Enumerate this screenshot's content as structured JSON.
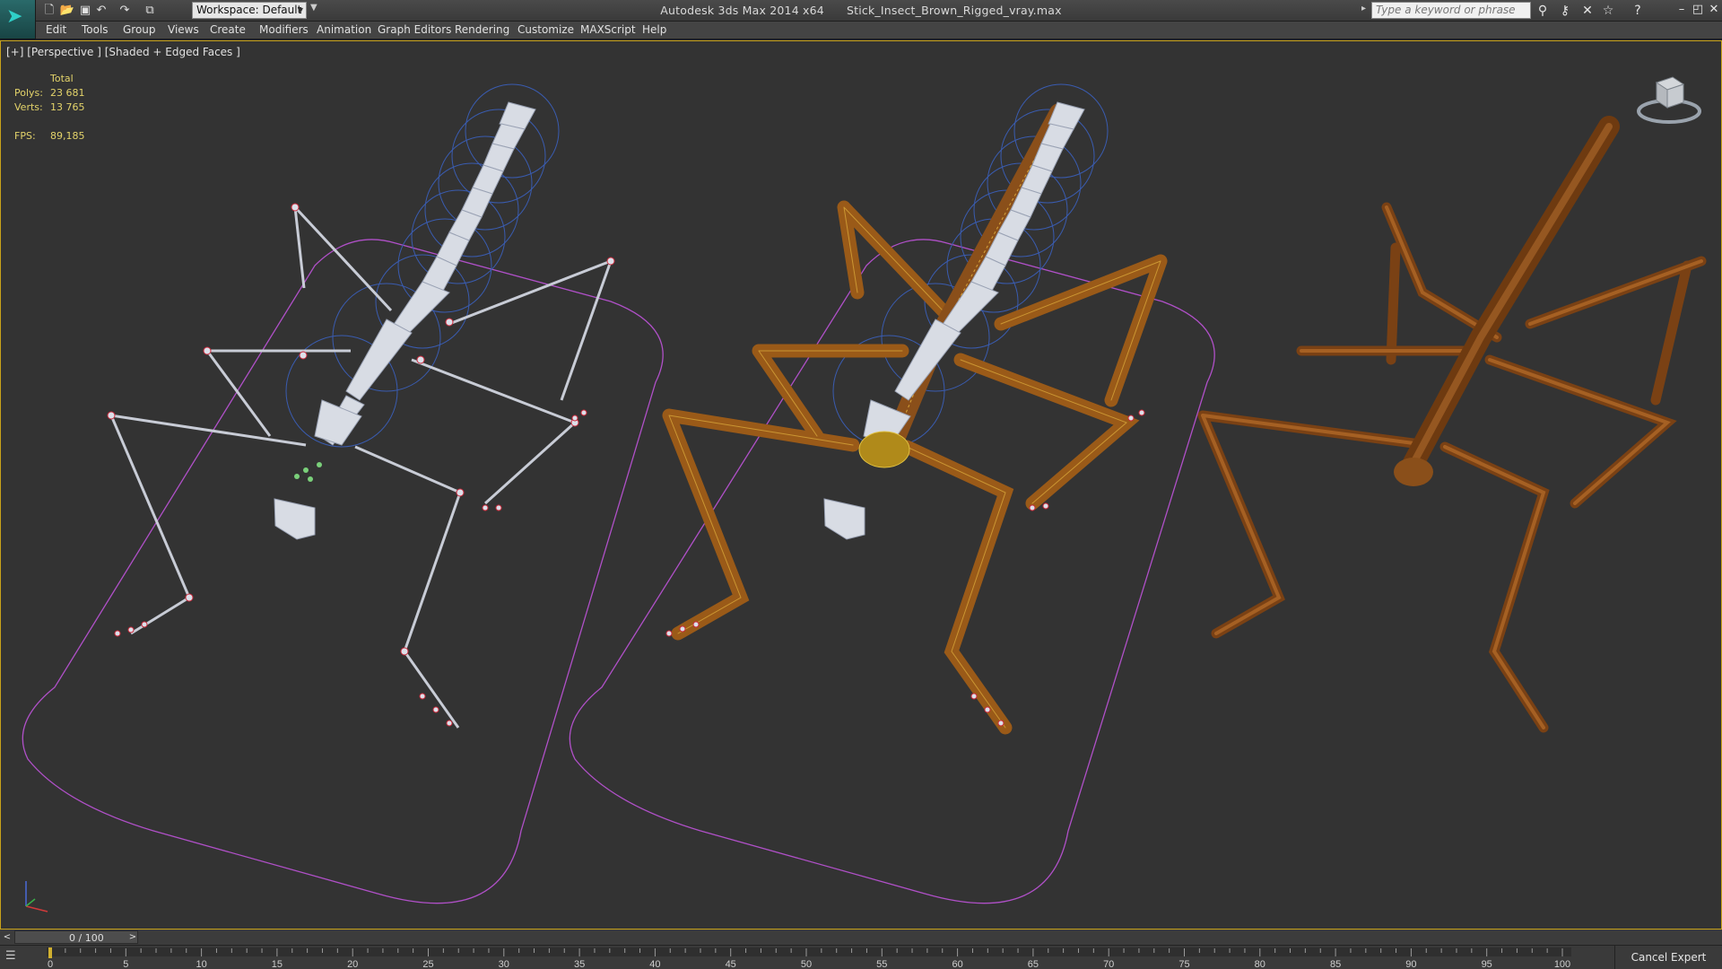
{
  "titlebar": {
    "app_title": "Autodesk 3ds Max  2014 x64",
    "file_name": "Stick_Insect_Brown_Rigged_vray.max",
    "workspace": "Workspace: Default",
    "search_placeholder": "Type a keyword or phrase"
  },
  "menu": {
    "items": [
      "Edit",
      "Tools",
      "Group",
      "Views",
      "Create",
      "Modifiers",
      "Animation",
      "Graph Editors",
      "Rendering",
      "Customize",
      "MAXScript",
      "Help"
    ]
  },
  "viewport": {
    "label": "[+] [Perspective ] [Shaded + Edged Faces ]",
    "stats": {
      "header": "Total",
      "polys_label": "Polys:",
      "polys_value": "23 681",
      "verts_label": "Verts:",
      "verts_value": "13 765",
      "fps_label": "FPS:",
      "fps_value": "89,185"
    }
  },
  "timeline": {
    "frame_display": "0 / 100",
    "prev_label": "<",
    "next_label": ">",
    "ticks": [
      "0",
      "5",
      "10",
      "15",
      "20",
      "25",
      "30",
      "35",
      "40",
      "45",
      "50",
      "55",
      "60",
      "65",
      "70",
      "75",
      "80",
      "85",
      "90",
      "95",
      "100"
    ]
  },
  "status": {
    "cancel_expert_mode": "Cancel Expert Mode"
  },
  "colors": {
    "viewport_bg": "#333333",
    "active_border": "#c8a21a",
    "stats_text": "#e3d36a",
    "spline": "#b050c8",
    "bone": "#d8dce4",
    "body_brown": "#8a4f1a"
  },
  "icons": [
    "app-logo-icon",
    "new-file-icon",
    "open-file-icon",
    "save-icon",
    "undo-icon",
    "redo-icon",
    "project-folder-icon",
    "binoculars-icon",
    "key-icon",
    "star-icon",
    "help-icon",
    "minimize-icon",
    "maximize-icon",
    "close-icon"
  ]
}
